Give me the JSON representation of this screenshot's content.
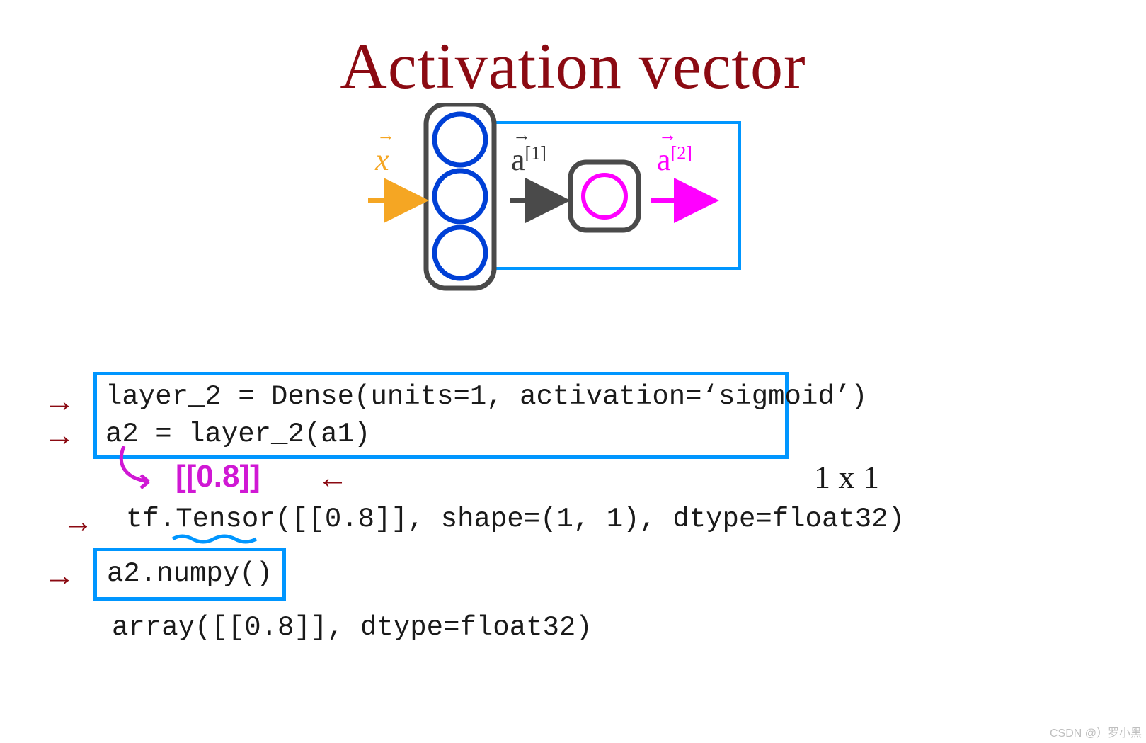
{
  "title": "Activation vector",
  "diagram": {
    "input_label": "x",
    "a1_label": "a",
    "a1_super": "[1]",
    "a2_label": "a",
    "a2_super": "[2]"
  },
  "code": {
    "line1": "layer_2 = Dense(units=1, activation=‘sigmoid’)",
    "line2": "a2 = layer_2(a1)",
    "hand_value": "[[0.8]]",
    "shape_label": "1 x 1",
    "tensor_line": "tf.Tensor([[0.8]], shape=(1, 1), dtype=float32)",
    "numpy_call": "a2.numpy()",
    "array_line": "array([[0.8]], dtype=float32)"
  },
  "arrows": {
    "right": "→",
    "left": "←"
  },
  "watermark": "CSDN @）罗小黑"
}
